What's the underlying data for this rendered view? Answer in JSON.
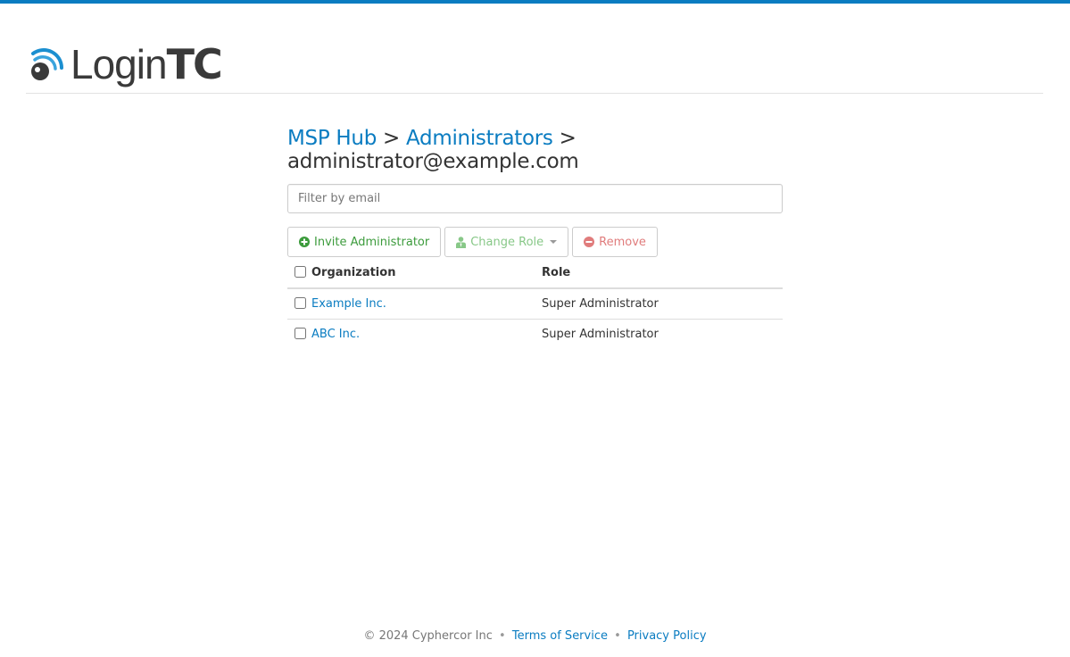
{
  "header": {
    "logo_text_light": "Login",
    "logo_text_bold": "TC",
    "brand_color": "#0a7cc1"
  },
  "breadcrumb": {
    "items": [
      {
        "label": "MSP Hub",
        "link": true
      },
      {
        "label": "Administrators",
        "link": true
      }
    ],
    "separator": ">",
    "current": "administrator@example.com"
  },
  "filter": {
    "placeholder": "Filter by email",
    "value": ""
  },
  "toolbar": {
    "invite_label": "Invite Administrator",
    "invite_icon": "plus-circle-icon",
    "change_role_label": "Change Role",
    "change_role_icon": "user-tie-icon",
    "remove_label": "Remove",
    "remove_icon": "minus-circle-icon"
  },
  "table": {
    "columns": [
      "Organization",
      "Role"
    ],
    "rows": [
      {
        "organization": "Example Inc.",
        "role": "Super Administrator",
        "checked": false
      },
      {
        "organization": "ABC Inc.",
        "role": "Super Administrator",
        "checked": false
      }
    ]
  },
  "footer": {
    "copyright": "© 2024 Cyphercor Inc",
    "bullet": "•",
    "terms_label": "Terms of Service",
    "privacy_label": "Privacy Policy"
  }
}
